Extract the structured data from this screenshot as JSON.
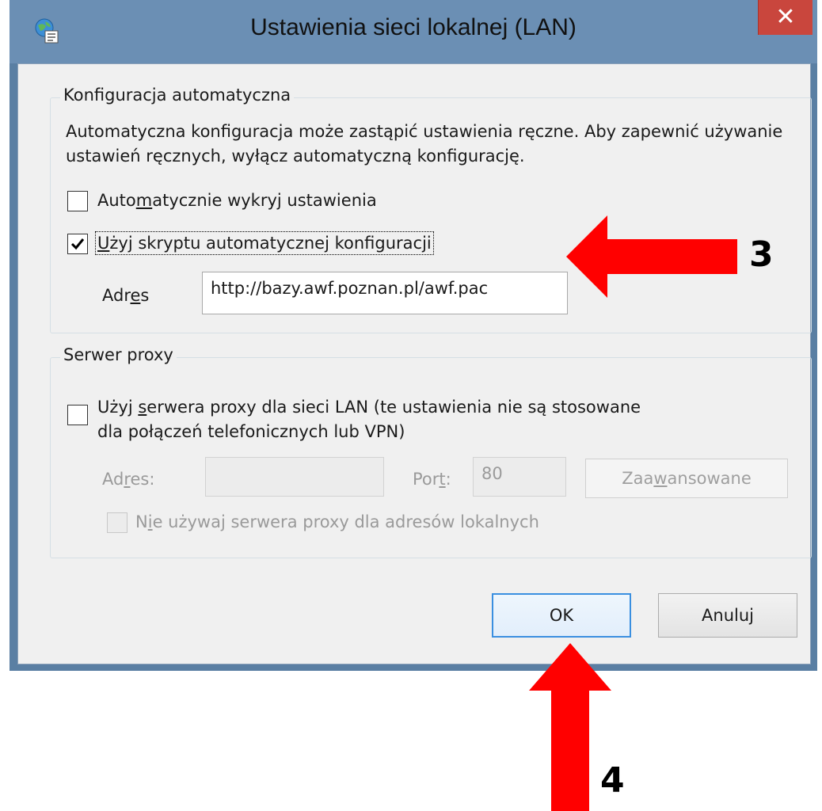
{
  "window": {
    "title": "Ustawienia sieci lokalnej (LAN)",
    "close_glyph": "✕"
  },
  "auto_config": {
    "legend": "Konfiguracja automatyczna",
    "description": "Automatyczna konfiguracja może zastąpić ustawienia ręczne. Aby zapewnić używanie ustawień ręcznych, wyłącz automatyczną konfigurację.",
    "detect_settings": {
      "label_pre": "Auto",
      "label_key": "m",
      "label_post": "atycznie wykryj ustawienia",
      "checked": false
    },
    "use_script": {
      "label_pre": "",
      "label_key": "U",
      "label_post": "żyj skryptu automatycznej konfiguracji",
      "checked": true
    },
    "address": {
      "label_pre": "Adr",
      "label_key": "e",
      "label_post": "s",
      "value": "http://bazy.awf.poznan.pl/awf.pac"
    }
  },
  "proxy": {
    "legend": "Serwer proxy",
    "use_proxy": {
      "label_pre": "Użyj ",
      "label_key": "s",
      "label_post": "erwera proxy dla sieci LAN (te ustawienia nie są stosowane",
      "label_line2": "dla połączeń telefonicznych lub VPN)",
      "checked": false
    },
    "address": {
      "label_pre": "Ad",
      "label_key": "r",
      "label_post": "es:",
      "value": ""
    },
    "port": {
      "label_pre": "Por",
      "label_key": "t",
      "label_post": ":",
      "value": "80"
    },
    "advanced": {
      "label_pre": "Zaa",
      "label_key": "w",
      "label_post": "ansowane"
    },
    "bypass_local": {
      "label_pre": "N",
      "label_key": "i",
      "label_post": "e używaj serwera proxy dla adresów lokalnych",
      "checked": false
    }
  },
  "buttons": {
    "ok": "OK",
    "cancel": "Anuluj"
  },
  "annotations": {
    "step3": "3",
    "step4": "4",
    "arrow_color": "#ff0000"
  }
}
